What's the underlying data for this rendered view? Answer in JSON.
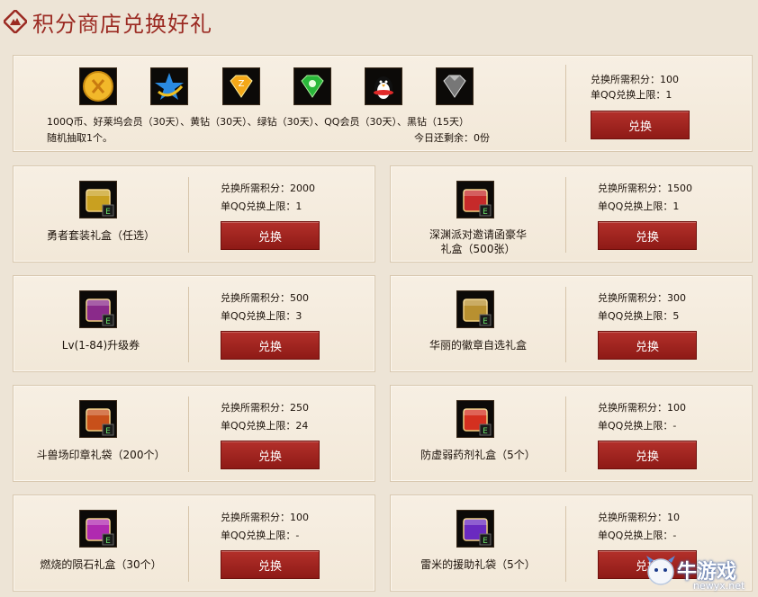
{
  "header": {
    "title": "积分商店兑换好礼",
    "icon": "mountain-diamond-icon"
  },
  "featured": {
    "icons": [
      "gold-coin-icon",
      "star-vip-icon",
      "yellow-diamond-icon",
      "green-diamond-icon",
      "qq-penguin-icon",
      "black-diamond-icon"
    ],
    "description_line1": "100Q币、好莱坞会员（30天）、黄钻（30天）、绿钻（30天）、QQ会员（30天）、黑钻（15天）",
    "description_line2": "随机抽取1个。",
    "remaining": "今日还剩余：0份",
    "cost": "兑换所需积分：100",
    "limit": "单QQ兑换上限：1",
    "button": "兑换"
  },
  "items": [
    {
      "name": "勇者套装礼盒（任选）",
      "cost": "兑换所需积分：2000",
      "limit": "单QQ兑换上限：1",
      "button": "兑换",
      "icon": "hero-box-icon",
      "color": "#c9a020"
    },
    {
      "name": "深渊派对邀请函豪华礼盒（500张）",
      "name_line1": "深渊派对邀请函豪华",
      "name_line2": "礼盒（500张）",
      "cost": "兑换所需积分：1500",
      "limit": "单QQ兑换上限：1",
      "button": "兑换",
      "icon": "abyss-box-icon",
      "color": "#c62a2a"
    },
    {
      "name": "Lv(1-84)升级券",
      "cost": "兑换所需积分：500",
      "limit": "单QQ兑换上限：3",
      "button": "兑换",
      "icon": "level-ticket-icon",
      "color": "#8a2a8a"
    },
    {
      "name": "华丽的徽章自选礼盒",
      "cost": "兑换所需积分：300",
      "limit": "单QQ兑换上限：5",
      "button": "兑换",
      "icon": "badge-box-icon",
      "color": "#b89030"
    },
    {
      "name": "斗兽场印章礼袋（200个）",
      "cost": "兑换所需积分：250",
      "limit": "单QQ兑换上限：24",
      "button": "兑换",
      "icon": "arena-seal-icon",
      "color": "#c8501a"
    },
    {
      "name": "防虚弱药剂礼盒（5个）",
      "cost": "兑换所需积分：100",
      "limit": "单QQ兑换上限：-",
      "button": "兑换",
      "icon": "potion-box-icon",
      "color": "#d43020"
    },
    {
      "name": "燃烧的陨石礼盒（30个）",
      "cost": "兑换所需积分：100",
      "limit": "单QQ兑换上限：-",
      "button": "兑换",
      "icon": "meteor-box-icon",
      "color": "#b02ab0"
    },
    {
      "name": "雷米的援助礼袋（5个）",
      "cost": "兑换所需积分：10",
      "limit": "单QQ兑换上限：-",
      "button": "兑换",
      "icon": "remy-bag-icon",
      "color": "#6a2ac0"
    }
  ],
  "watermark": {
    "text": "牛游戏",
    "url": "newyx.net"
  }
}
